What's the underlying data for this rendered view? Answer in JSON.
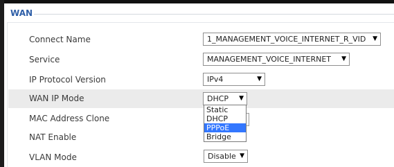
{
  "section": {
    "title": "WAN"
  },
  "fields": [
    {
      "label": "Connect Name",
      "value": "1_MANAGEMENT_VOICE_INTERNET_R_VID"
    },
    {
      "label": "Service",
      "value": "MANAGEMENT_VOICE_INTERNET"
    },
    {
      "label": "IP Protocol Version",
      "value": "IPv4"
    },
    {
      "label": "WAN IP Mode",
      "value": "DHCP"
    },
    {
      "label": "MAC Address Clone"
    },
    {
      "label": "NAT Enable"
    },
    {
      "label": "VLAN Mode",
      "value": "Disable"
    }
  ],
  "caret": "▼",
  "dropdown": {
    "options": [
      "Static",
      "DHCP",
      "PPPoE",
      "Bridge"
    ],
    "highlighted": "PPPoE"
  }
}
